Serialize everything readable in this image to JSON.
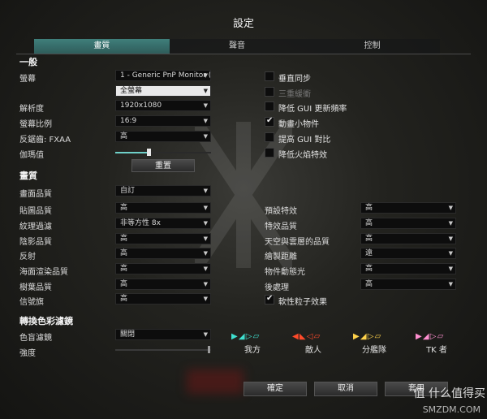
{
  "window": {
    "title": "設定"
  },
  "tabs": [
    {
      "label": "畫質",
      "active": true
    },
    {
      "label": "聲音",
      "active": false
    },
    {
      "label": "控制",
      "active": false
    }
  ],
  "general": {
    "heading": "一般",
    "monitor": {
      "label": "螢幕",
      "value": "1 - Generic PnP Monitor (p",
      "mode": "全螢幕"
    },
    "resolution": {
      "label": "解析度",
      "value": "1920x1080"
    },
    "aspect": {
      "label": "螢幕比例",
      "value": "16:9"
    },
    "antialias": {
      "label": "反鋸齒: FXAA",
      "value": "高"
    },
    "gamma": {
      "label": "伽瑪值",
      "level": 0.35
    },
    "reset_label": "重置",
    "options": [
      {
        "label": "垂直同步",
        "checked": false,
        "disabled": false
      },
      {
        "label": "三重緩衝",
        "checked": false,
        "disabled": true
      },
      {
        "label": "降低 GUI 更新頻率",
        "checked": false,
        "disabled": false
      },
      {
        "label": "動畫小物件",
        "checked": true,
        "disabled": false
      },
      {
        "label": "提高 GUI 對比",
        "checked": false,
        "disabled": false
      },
      {
        "label": "降低火焰特效",
        "checked": false,
        "disabled": false
      }
    ]
  },
  "quality": {
    "heading": "畫質",
    "preset": {
      "label": "畫面品質",
      "value": "自訂"
    },
    "left": [
      {
        "label": "貼圖品質",
        "value": "高"
      },
      {
        "label": "紋理過濾",
        "value": "非等方性 8x"
      },
      {
        "label": "陰影品質",
        "value": "高"
      },
      {
        "label": "反射",
        "value": "高"
      },
      {
        "label": "海面渲染品質",
        "value": "高"
      },
      {
        "label": "樹葉品質",
        "value": "高"
      },
      {
        "label": "信號旗",
        "value": "高"
      }
    ],
    "right": [
      {
        "label": "預設特效",
        "value": "高"
      },
      {
        "label": "特效品質",
        "value": "高"
      },
      {
        "label": "天空與雲層的品質",
        "value": "高"
      },
      {
        "label": "繪製距離",
        "value": "遠"
      },
      {
        "label": "物件動態光",
        "value": "高"
      },
      {
        "label": "後處理",
        "value": "高"
      }
    ],
    "soft_particles": {
      "label": "軟性粒子效果",
      "checked": true
    }
  },
  "colorblind": {
    "heading": "轉換色彩濾鏡",
    "filter": {
      "label": "色盲濾鏡",
      "value": "關閉"
    },
    "intensity": {
      "label": "強度",
      "level": 0.98
    },
    "teams": [
      {
        "label": "我方",
        "glyphs": "▶ ◢ ▷ ▱",
        "color": "#3fe0d0"
      },
      {
        "label": "敵人",
        "glyphs": "◀ ◣ ◁ ▱",
        "color": "#ff4a2a"
      },
      {
        "label": "分艦隊",
        "glyphs": "▶ ◢ ▷ ▱",
        "color": "#ffd24a"
      },
      {
        "label": "TK 者",
        "glyphs": "▶ ◢ ▷ ▱",
        "color": "#ff8fd0"
      }
    ]
  },
  "footer": {
    "ok_label": "確定",
    "cancel_label": "取消",
    "apply_label": "套用"
  },
  "watermark": {
    "text": "值 什么值得买",
    "site": "SMZDM.COM"
  }
}
